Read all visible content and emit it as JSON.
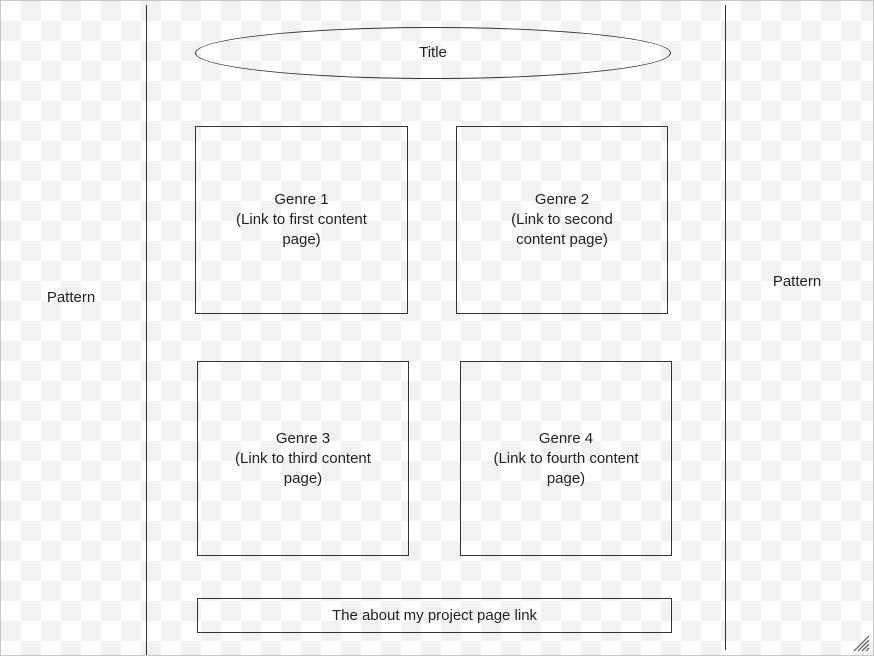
{
  "sidebars": {
    "left_label": "Pattern",
    "right_label": "Pattern"
  },
  "header": {
    "title": "Title"
  },
  "genres": [
    {
      "text": "Genre 1\n(Link to first content\npage)"
    },
    {
      "text": "Genre 2\n(Link to second\ncontent page)"
    },
    {
      "text": "Genre 3\n(Link to third content\npage)"
    },
    {
      "text": "Genre 4\n(Link to fourth content\npage)"
    }
  ],
  "footer": {
    "about_link": "The about my project page link"
  },
  "icons": {
    "resize_grip": "resize-grip-icon"
  },
  "colors": {
    "stroke": "#333333",
    "checker": "#f2f2f2",
    "background": "#ffffff"
  }
}
